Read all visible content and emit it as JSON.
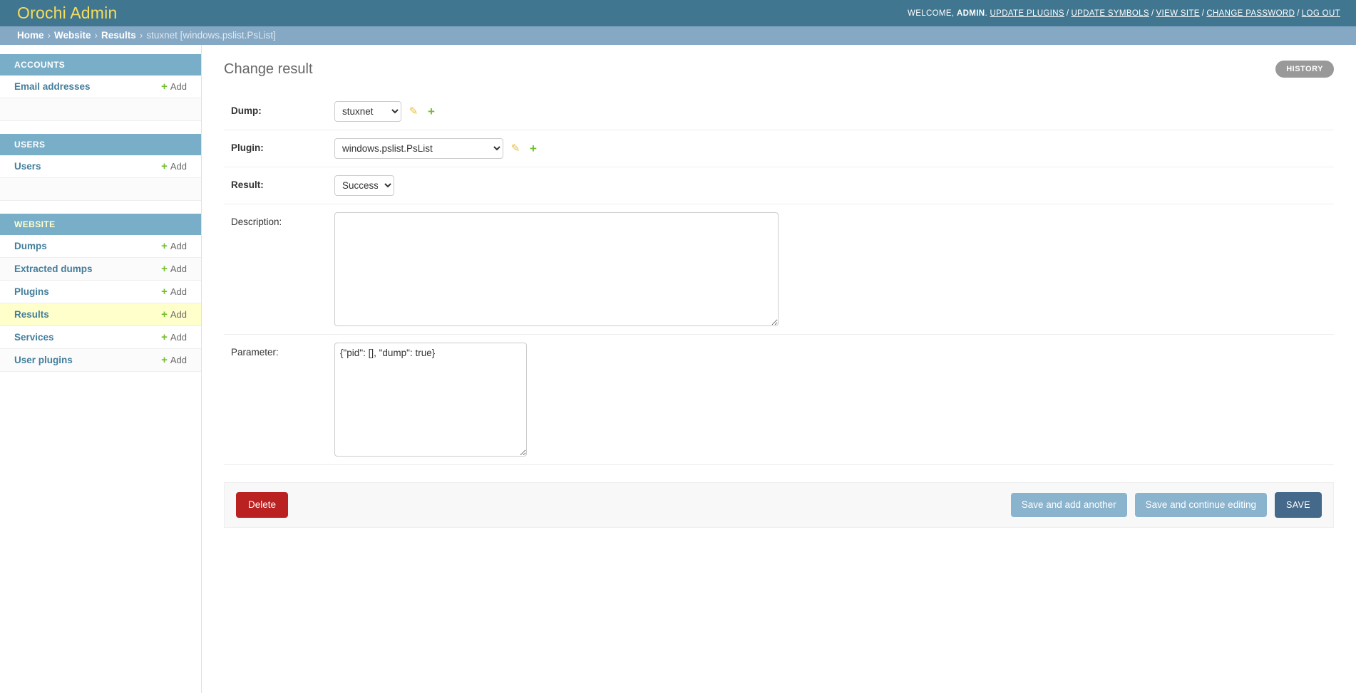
{
  "header": {
    "site_title": "Orochi Admin",
    "welcome_text": "WELCOME,",
    "username": "ADMIN",
    "username_suffix": ".",
    "links": [
      {
        "label": "UPDATE PLUGINS",
        "name": "update-plugins-link"
      },
      {
        "label": "UPDATE SYMBOLS",
        "name": "update-symbols-link"
      },
      {
        "label": "VIEW SITE",
        "name": "view-site-link"
      },
      {
        "label": "CHANGE PASSWORD",
        "name": "change-password-link"
      },
      {
        "label": "LOG OUT",
        "name": "log-out-link"
      }
    ],
    "separator": "/"
  },
  "breadcrumbs": {
    "items": [
      {
        "label": "Home"
      },
      {
        "label": "Website"
      },
      {
        "label": "Results"
      }
    ],
    "current": "stuxnet [windows.pslist.PsList]",
    "separator": "›"
  },
  "sidebar": {
    "groups": [
      {
        "caption": "ACCOUNTS",
        "current": false,
        "models": [
          {
            "label": "Email addresses",
            "add_label": "Add",
            "current": false
          }
        ]
      },
      {
        "caption": "USERS",
        "current": false,
        "models": [
          {
            "label": "Users",
            "add_label": "Add",
            "current": false
          }
        ]
      },
      {
        "caption": "WEBSITE",
        "current": true,
        "models": [
          {
            "label": "Dumps",
            "add_label": "Add",
            "current": false
          },
          {
            "label": "Extracted dumps",
            "add_label": "Add",
            "current": false
          },
          {
            "label": "Plugins",
            "add_label": "Add",
            "current": false
          },
          {
            "label": "Results",
            "add_label": "Add",
            "current": true
          },
          {
            "label": "Services",
            "add_label": "Add",
            "current": false
          },
          {
            "label": "User plugins",
            "add_label": "Add",
            "current": false
          }
        ]
      }
    ],
    "add_icon": "+"
  },
  "main": {
    "page_title": "Change result",
    "history_label": "HISTORY",
    "fields": {
      "dump": {
        "label": "Dump:",
        "value": "stuxnet",
        "options": [
          "stuxnet"
        ],
        "edit_icon": "✎",
        "add_icon": "+"
      },
      "plugin": {
        "label": "Plugin:",
        "value": "windows.pslist.PsList",
        "options": [
          "windows.pslist.PsList"
        ],
        "edit_icon": "✎",
        "add_icon": "+"
      },
      "result": {
        "label": "Result:",
        "value": "Success",
        "options": [
          "Success"
        ]
      },
      "description": {
        "label": "Description:",
        "value": "",
        "placeholder": ""
      },
      "parameter": {
        "label": "Parameter:",
        "value": "{\"pid\": [], \"dump\": true}",
        "placeholder": ""
      }
    },
    "submit_row": {
      "delete_label": "Delete",
      "save_add_another_label": "Save and add another",
      "save_continue_label": "Save and continue editing",
      "save_label": "SAVE"
    }
  },
  "colors": {
    "header_bg": "#417690",
    "breadcrumb_bg": "#85a8c4",
    "brand_text": "#f5dd5d",
    "module_caption_bg": "#79aec8",
    "current_model_bg": "#ffffcc",
    "link_blue": "#447e9b",
    "add_green": "#70bf2b",
    "edit_yellow": "#e8c04a",
    "delete_red": "#ba2121",
    "save_blue": "#44698a",
    "secondary_button": "#8ab3cd",
    "history_gray": "#999999"
  }
}
